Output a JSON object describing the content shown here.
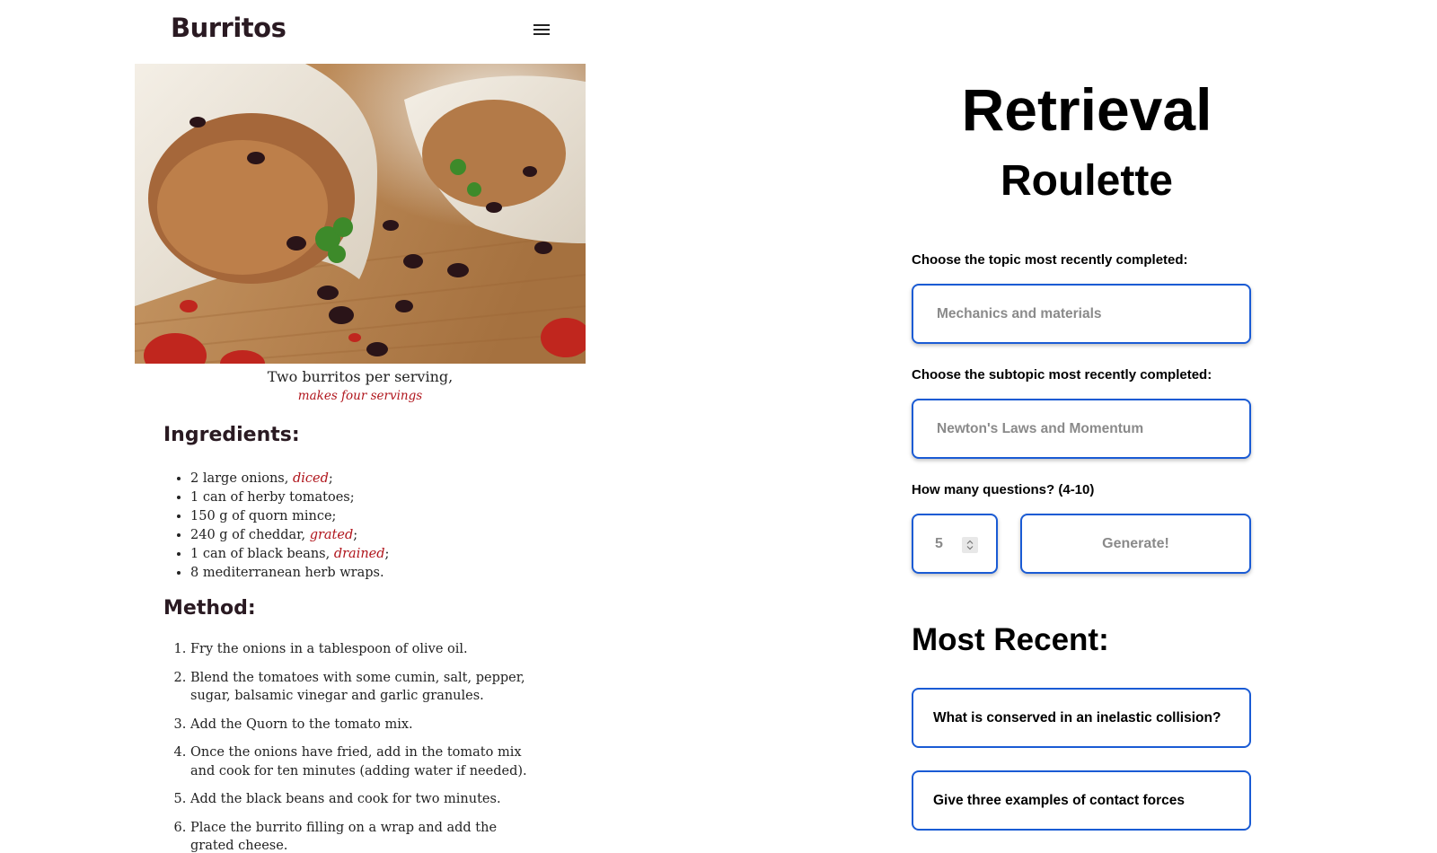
{
  "recipe": {
    "title": "Burritos",
    "caption": "Two burritos per serving,",
    "caption_sub": "makes four servings",
    "ingredients_heading": "Ingredients:",
    "ingredients": [
      {
        "text": "2 large onions, ",
        "note": "diced",
        "end": ";"
      },
      {
        "text": "1 can of herby tomatoes;",
        "note": "",
        "end": ""
      },
      {
        "text": "150 g of quorn mince;",
        "note": "",
        "end": ""
      },
      {
        "text": "240 g of cheddar, ",
        "note": "grated",
        "end": ";"
      },
      {
        "text": "1 can of black beans, ",
        "note": "drained",
        "end": ";"
      },
      {
        "text": "8 mediterranean herb wraps.",
        "note": "",
        "end": ""
      }
    ],
    "method_heading": "Method:",
    "method": [
      "Fry the onions in a tablespoon of olive oil.",
      "Blend the tomatoes with some cumin, salt, pepper, sugar, balsamic vinegar and garlic granules.",
      "Add the Quorn to the tomato mix.",
      "Once the onions have fried, add in the tomato mix and cook for ten minutes (adding water if needed).",
      "Add the black beans and cook for two minutes.",
      "Place the burrito filling on a wrap and add the grated cheese."
    ],
    "accent_color": "#b0151c"
  },
  "quiz": {
    "title_line1": "Retrieval",
    "title_line2": "Roulette",
    "topic_label": "Choose the topic most recently completed:",
    "topic_value": "Mechanics and materials",
    "subtopic_label": "Choose the subtopic most recently completed:",
    "subtopic_value": "Newton's Laws and Momentum",
    "count_label": "How many questions? (4-10)",
    "count_value": "5",
    "generate_label": "Generate!",
    "recent_heading": "Most Recent:",
    "recent": [
      "What is conserved in an inelastic collision?",
      "Give three examples of contact forces"
    ],
    "accent_color": "#1a5bd4"
  }
}
